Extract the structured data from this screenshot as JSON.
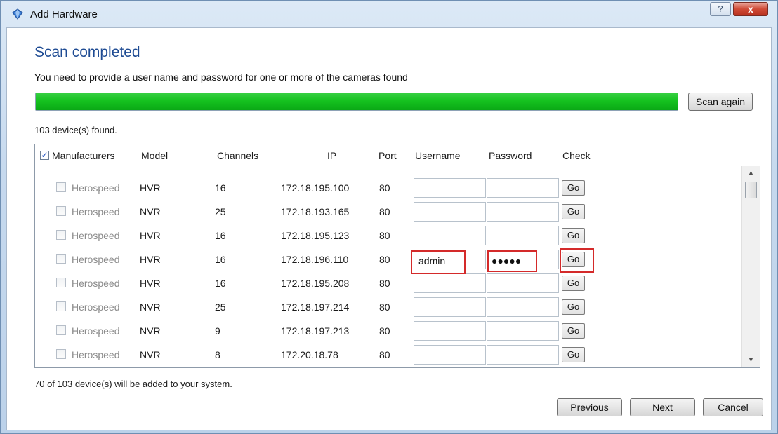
{
  "window": {
    "title": "Add Hardware",
    "help_label": "?",
    "close_label": "x"
  },
  "heading": "Scan completed",
  "subtitle": "You need to provide a user name and password for one or more of the cameras found",
  "progress": {
    "percent": 100,
    "color": "#1ec42a"
  },
  "scan_again_label": "Scan again",
  "found_text": "103 device(s) found.",
  "columns": {
    "manufacturers": "Manufacturers",
    "model": "Model",
    "channels": "Channels",
    "ip": "IP",
    "port": "Port",
    "username": "Username",
    "password": "Password",
    "check": "Check"
  },
  "header_checkbox_checked": true,
  "rows": [
    {
      "manufacturer": "Herospeed",
      "model": "HVR",
      "channels": "16",
      "ip": "172.18.195.100",
      "port": "80",
      "username": "",
      "password": "",
      "go": "Go"
    },
    {
      "manufacturer": "Herospeed",
      "model": "NVR",
      "channels": "25",
      "ip": "172.18.193.165",
      "port": "80",
      "username": "",
      "password": "",
      "go": "Go"
    },
    {
      "manufacturer": "Herospeed",
      "model": "HVR",
      "channels": "16",
      "ip": "172.18.195.123",
      "port": "80",
      "username": "",
      "password": "",
      "go": "Go"
    },
    {
      "manufacturer": "Herospeed",
      "model": "HVR",
      "channels": "16",
      "ip": "172.18.196.110",
      "port": "80",
      "username": "admin",
      "password": "●●●●●",
      "go": "Go"
    },
    {
      "manufacturer": "Herospeed",
      "model": "HVR",
      "channels": "16",
      "ip": "172.18.195.208",
      "port": "80",
      "username": "",
      "password": "",
      "go": "Go"
    },
    {
      "manufacturer": "Herospeed",
      "model": "NVR",
      "channels": "25",
      "ip": "172.18.197.214",
      "port": "80",
      "username": "",
      "password": "",
      "go": "Go"
    },
    {
      "manufacturer": "Herospeed",
      "model": "NVR",
      "channels": "9",
      "ip": "172.18.197.213",
      "port": "80",
      "username": "",
      "password": "",
      "go": "Go"
    },
    {
      "manufacturer": "Herospeed",
      "model": "NVR",
      "channels": "8",
      "ip": "172.20.18.78",
      "port": "80",
      "username": "",
      "password": "",
      "go": "Go"
    }
  ],
  "added_text": "70 of 103 device(s) will be added to your system.",
  "buttons": {
    "previous": "Previous",
    "next": "Next",
    "cancel": "Cancel"
  },
  "highlight_color": "#d42a2a"
}
